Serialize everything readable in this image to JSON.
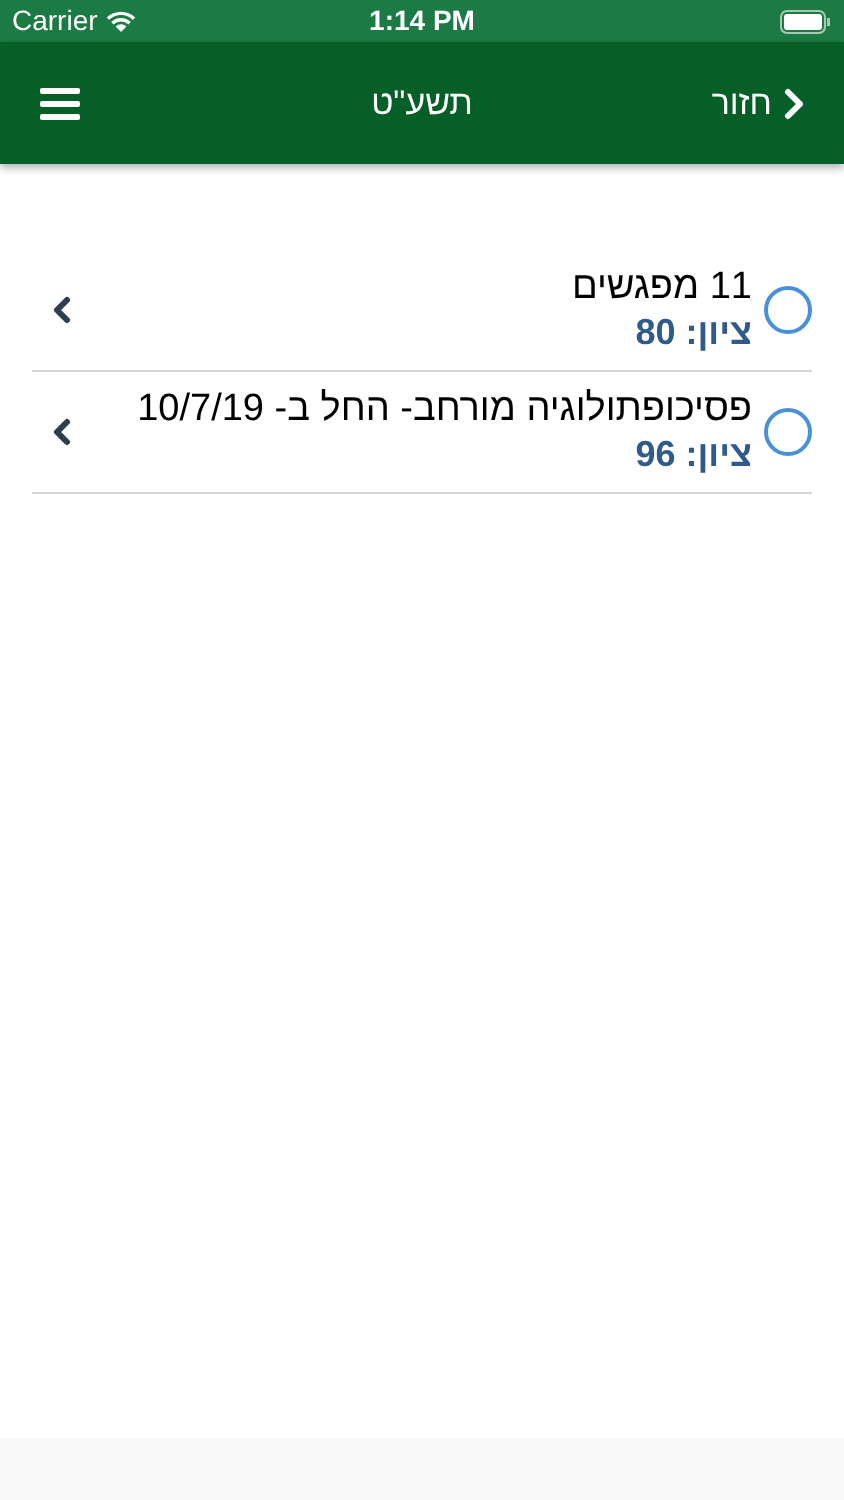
{
  "status_bar": {
    "carrier": "Carrier",
    "time": "1:14 PM"
  },
  "nav_bar": {
    "back": "חזור",
    "title": "תשע\"ט"
  },
  "courses": [
    {
      "title": "11 מפגשים",
      "grade": "ציון: 80",
      "checked": false
    },
    {
      "title": "פסיכופתולוגיה מורחב- החל ב- 10/7/19",
      "grade": "ציון: 96",
      "checked": false
    }
  ]
}
